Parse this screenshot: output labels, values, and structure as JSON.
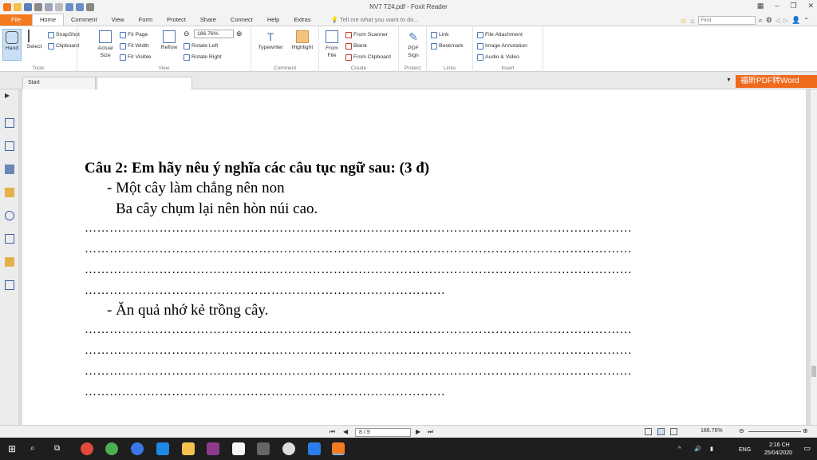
{
  "window": {
    "title": "NV7 T24.pdf - Foxit Reader"
  },
  "ribbon_tabs": [
    "File",
    "Home",
    "Comment",
    "View",
    "Form",
    "Protect",
    "Share",
    "Connect",
    "Help",
    "Extras"
  ],
  "tell_me": "Tell me what you want to do...",
  "find_placeholder": "Find",
  "ribbon": {
    "tools": {
      "label": "Tools",
      "hand": "Hand",
      "select": "Select",
      "snapshot": "SnapShot",
      "clipboard": "Clipboard"
    },
    "view": {
      "label": "View",
      "actual_size": "Actual Size",
      "fit_page": "Fit Page",
      "fit_width": "Fit Width",
      "fit_visible": "Fit Visible",
      "reflow": "Reflow",
      "zoom": "186.76%",
      "rotate_left": "Rotate Left",
      "rotate_right": "Rotate Right"
    },
    "comment": {
      "label": "Comment",
      "typewriter": "Typewriter",
      "highlight": "Highlight"
    },
    "create": {
      "label": "Create",
      "from_file": "From File",
      "from_scanner": "From Scanner",
      "blank": "Blank",
      "from_clipboard": "From Clipboard"
    },
    "protect": {
      "label": "Protect",
      "pdf_sign": "PDF Sign"
    },
    "links": {
      "label": "Links",
      "link": "Link",
      "bookmark": "Bookmark"
    },
    "insert": {
      "label": "Insert",
      "file_attachment": "File Attachment",
      "image_annotation": "Image Annotation",
      "audio_video": "Audio & Video"
    }
  },
  "doc_tabs": {
    "start": "Start"
  },
  "promo": "福昕PDF转Word",
  "document": {
    "heading": "Câu 2: Em hãy nêu ý nghĩa các câu tục ngữ sau: (3 đ)",
    "bullet1_line1": "-    Một cây làm chẳng nên non",
    "bullet1_line2": "Ba cây chụm lại nên hòn núi cao.",
    "bullet2": "-    Ăn quả nhớ kẻ trồng cây.",
    "dots_full": "……………………………………………………………………………………………………………………",
    "dots_short": "……………………………………………………………………………"
  },
  "status": {
    "page": "8 / 9",
    "zoom": "186.76%"
  },
  "taskbar": {
    "lang": "ENG",
    "time": "2:16 CH",
    "date": "25/04/2020"
  },
  "colors": {
    "accent": "#f47a20",
    "ribbon_icon": "#4a78b5",
    "taskbar": "#1e1e1e"
  }
}
